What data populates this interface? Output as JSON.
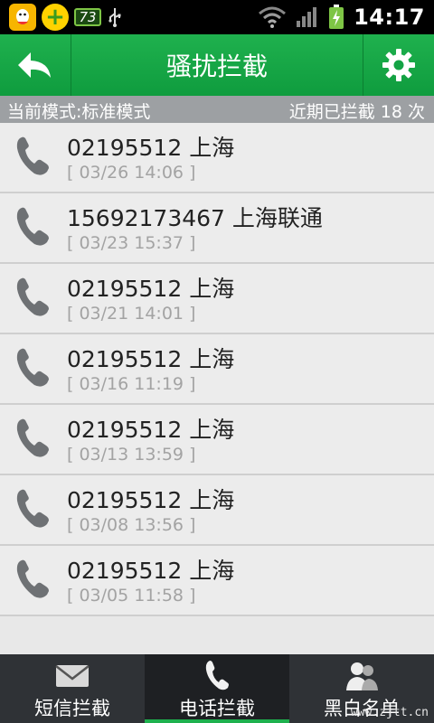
{
  "status_bar": {
    "battery_small": "73",
    "time": "14:17"
  },
  "header": {
    "title": "骚扰拦截"
  },
  "mode_bar": {
    "mode_text": "当前模式:标准模式",
    "count_text": "近期已拦截 18 次"
  },
  "calls": [
    {
      "number": "02195512 上海",
      "time": "[ 03/26 14:06 ]"
    },
    {
      "number": "15692173467 上海联通",
      "time": "[ 03/23 15:37 ]"
    },
    {
      "number": "02195512 上海",
      "time": "[ 03/21 14:01 ]"
    },
    {
      "number": "02195512 上海",
      "time": "[ 03/16 11:19 ]"
    },
    {
      "number": "02195512 上海",
      "time": "[ 03/13 13:59 ]"
    },
    {
      "number": "02195512 上海",
      "time": "[ 03/08 13:56 ]"
    },
    {
      "number": "02195512 上海",
      "time": "[ 03/05 11:58 ]"
    }
  ],
  "tabs": [
    {
      "label": "短信拦截",
      "icon": "envelope-icon"
    },
    {
      "label": "电话拦截",
      "icon": "phone-icon"
    },
    {
      "label": "黑白名单",
      "icon": "contacts-icon"
    }
  ],
  "watermark": "www.zjtt.cn",
  "colors": {
    "accent_green": "#1fb14e",
    "mode_bar_gray": "#9da0a3",
    "tab_bar": "#2f3236"
  }
}
